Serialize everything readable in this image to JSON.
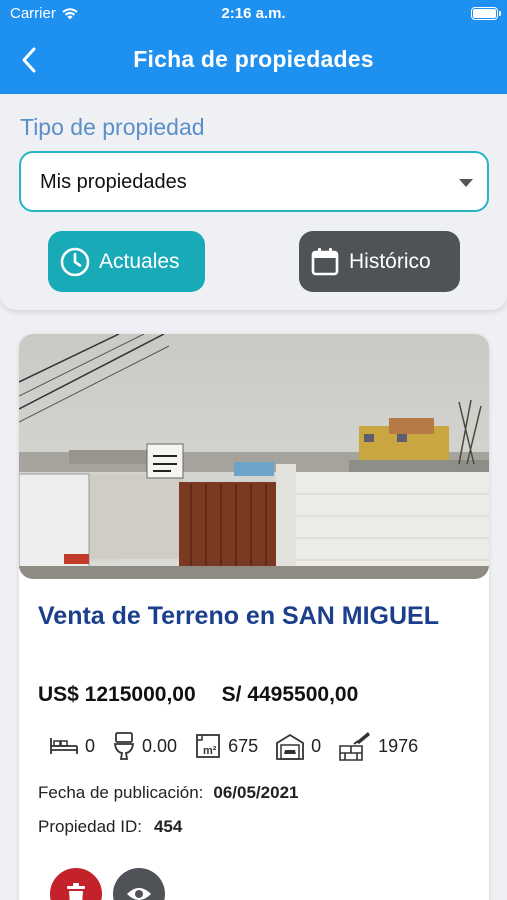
{
  "status_bar": {
    "carrier": "Carrier",
    "time": "2:16 a.m."
  },
  "navbar": {
    "title": "Ficha de propiedades"
  },
  "filter": {
    "label": "Tipo de propiedad",
    "selected": "Mis propiedades",
    "buttons": {
      "current": "Actuales",
      "history": "Histórico"
    }
  },
  "listing": {
    "title": "Venta de Terreno en SAN MIGUEL",
    "price_usd": "US$ 1215000,00",
    "price_pen": "S/ 4495500,00",
    "features": {
      "bedrooms": "0",
      "bathrooms": "0.00",
      "area": "675",
      "garages": "0",
      "year_built": "1976"
    },
    "date_label": "Fecha de publicación:",
    "date_value": "06/05/2021",
    "id_label": "Propiedad ID:",
    "id_value": "454"
  },
  "colors": {
    "header": "#1e90f0",
    "accent": "#19aab8",
    "secondary": "#4f5358",
    "title": "#1b3f8c",
    "danger": "#c4222b"
  }
}
